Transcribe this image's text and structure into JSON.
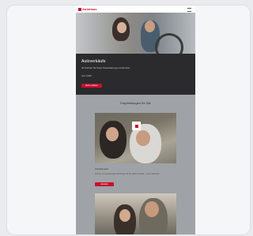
{
  "header": {
    "logo_text": "Autohaus"
  },
  "hero": {
    "title": "Autoverkäufe",
    "subtitle": "Ihr Partner für Kauf, Finanzierung und Service",
    "meta": "Seit 1998",
    "cta_label": "Mehr erfahren"
  },
  "section": {
    "title": "Empfehlungen für Sie"
  },
  "card1": {
    "title": "Familienauto",
    "text": "Sichere und geräumige Fahrzeuge für die ganze Familie – jetzt entdecken.",
    "cta_label": "Ansehen"
  },
  "colors": {
    "accent": "#c8102e",
    "dark_panel": "#2b2b2d",
    "page_bg": "#9fa2a6"
  }
}
